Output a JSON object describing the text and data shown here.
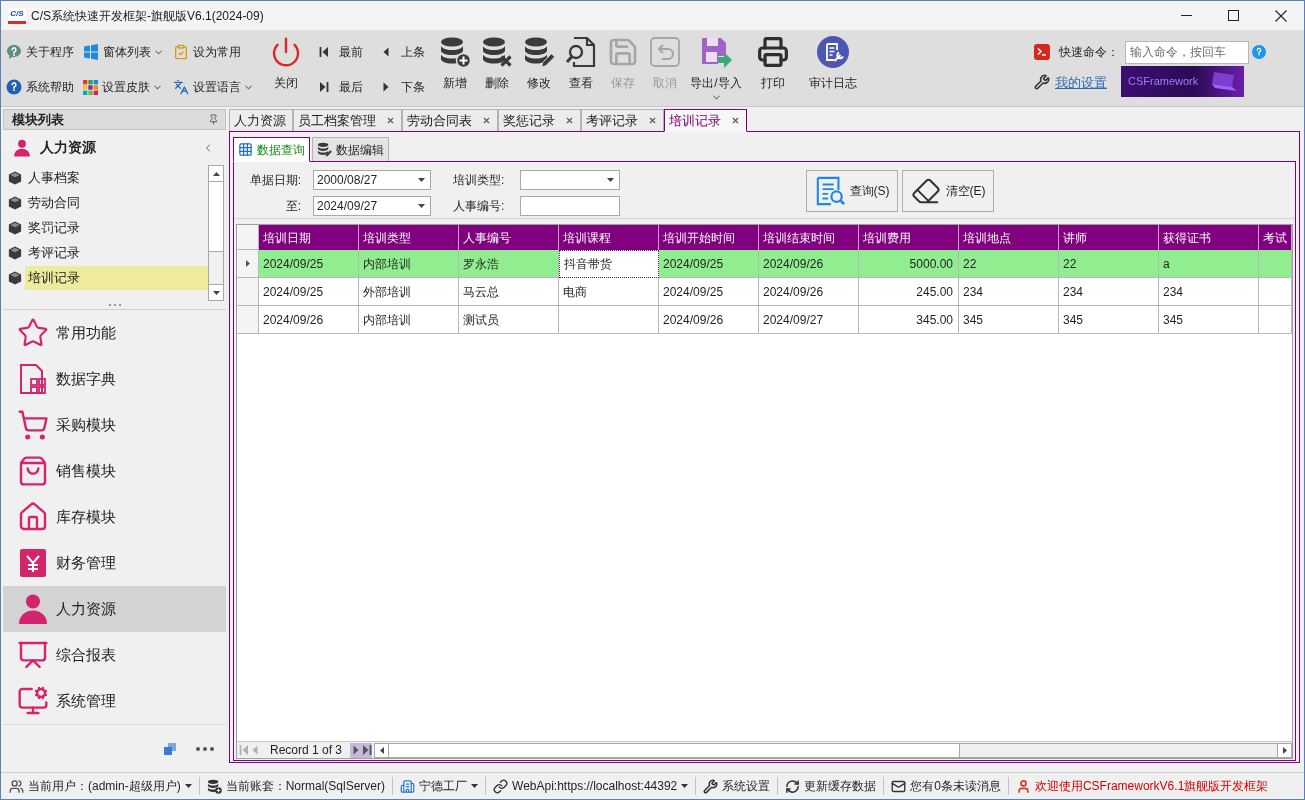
{
  "window": {
    "logo": "C/S",
    "title": "C/S系统快速开发框架-旗舰版V6.1(2024-09)"
  },
  "toolbar": {
    "small_buttons": [
      {
        "label": "关于程序",
        "dropdown": false
      },
      {
        "label": "系统帮助",
        "dropdown": false
      },
      {
        "label": "窗体列表",
        "dropdown": true
      },
      {
        "label": "设置皮肤",
        "dropdown": true
      },
      {
        "label": "设为常用",
        "dropdown": false
      },
      {
        "label": "设置语言",
        "dropdown": true
      }
    ],
    "close_button": "关闭",
    "record_nav": [
      "最前",
      "最后",
      "上条",
      "下条"
    ],
    "actions": [
      {
        "label": "新增",
        "disabled": false,
        "dropdown": false
      },
      {
        "label": "删除",
        "disabled": false,
        "dropdown": false
      },
      {
        "label": "修改",
        "disabled": false,
        "dropdown": false
      },
      {
        "label": "查看",
        "disabled": false,
        "dropdown": false
      },
      {
        "label": "保存",
        "disabled": true,
        "dropdown": false
      },
      {
        "label": "取消",
        "disabled": true,
        "dropdown": false
      },
      {
        "label": "导出/导入",
        "disabled": false,
        "dropdown": true
      },
      {
        "label": "打印",
        "disabled": false,
        "dropdown": false
      },
      {
        "label": "审计日志",
        "disabled": false,
        "dropdown": false
      }
    ],
    "quick_command": {
      "label": "快速命令：",
      "placeholder": "输入命令，按回车"
    },
    "settings_link": "我的设置",
    "banner": "CSFramework"
  },
  "sidebar": {
    "title": "模块列表",
    "group": "人力资源",
    "items": [
      {
        "label": "人事档案",
        "selected": false
      },
      {
        "label": "劳动合同",
        "selected": false
      },
      {
        "label": "奖罚记录",
        "selected": false
      },
      {
        "label": "考评记录",
        "selected": false
      },
      {
        "label": "培训记录",
        "selected": true
      }
    ],
    "modules": [
      {
        "label": "常用功能",
        "selected": false
      },
      {
        "label": "数据字典",
        "selected": false
      },
      {
        "label": "采购模块",
        "selected": false
      },
      {
        "label": "销售模块",
        "selected": false
      },
      {
        "label": "库存模块",
        "selected": false
      },
      {
        "label": "财务管理",
        "selected": false
      },
      {
        "label": "人力资源",
        "selected": true
      },
      {
        "label": "综合报表",
        "selected": false
      },
      {
        "label": "系统管理",
        "selected": false
      }
    ]
  },
  "tabs": [
    {
      "label": "人力资源",
      "closable": false,
      "selected": false
    },
    {
      "label": "员工档案管理",
      "closable": true,
      "selected": false
    },
    {
      "label": "劳动合同表",
      "closable": true,
      "selected": false
    },
    {
      "label": "奖惩记录",
      "closable": true,
      "selected": false
    },
    {
      "label": "考评记录",
      "closable": true,
      "selected": false
    },
    {
      "label": "培训记录",
      "closable": true,
      "selected": true
    }
  ],
  "sub_tabs": [
    {
      "label": "数据查询",
      "selected": true
    },
    {
      "label": "数据编辑",
      "selected": false
    }
  ],
  "filters": [
    {
      "label": "单据日期:",
      "kind": "date",
      "value": "2000/08/27"
    },
    {
      "label": "培训类型:",
      "kind": "dropdown"
    },
    {
      "label": "至:",
      "kind": "date",
      "value": "2024/09/27"
    },
    {
      "label": "人事编号:",
      "kind": "text"
    }
  ],
  "filter_buttons": [
    "查询(S)",
    "清空(E)"
  ],
  "table": {
    "columns": [
      {
        "label": "培训日期",
        "kind": "text"
      },
      {
        "label": "培训类型",
        "kind": "text"
      },
      {
        "label": "人事编号",
        "kind": "text"
      },
      {
        "label": "培训课程",
        "kind": "text"
      },
      {
        "label": "培训开始时间",
        "kind": "text"
      },
      {
        "label": "培训结束时间",
        "kind": "text"
      },
      {
        "label": "培训费用",
        "kind": "number"
      },
      {
        "label": "培训地点",
        "kind": "text"
      },
      {
        "label": "讲师",
        "kind": "text"
      },
      {
        "label": "获得证书",
        "kind": "text"
      },
      {
        "label": "考试",
        "kind": "text"
      }
    ],
    "rows": [
      {
        "selected": true,
        "cells": [
          {
            "text": "2024/09/25",
            "focused": false
          },
          {
            "text": "内部培训",
            "focused": false
          },
          {
            "text": "罗永浩",
            "focused": false
          },
          {
            "text": "抖音带货",
            "focused": true
          },
          {
            "text": "2024/09/25",
            "focused": false
          },
          {
            "text": "2024/09/26",
            "focused": false
          },
          {
            "text": "5000.00",
            "focused": false
          },
          {
            "text": "22",
            "focused": false
          },
          {
            "text": "22",
            "focused": false
          },
          {
            "text": "a",
            "focused": false
          },
          {
            "focused": false
          }
        ]
      },
      {
        "selected": false,
        "cells": [
          {
            "text": "2024/09/25",
            "focused": false
          },
          {
            "text": "外部培训",
            "focused": false
          },
          {
            "text": "马云总",
            "focused": false
          },
          {
            "text": "电商",
            "focused": false
          },
          {
            "text": "2024/09/25",
            "focused": false
          },
          {
            "text": "2024/09/26",
            "focused": false
          },
          {
            "text": "245.00",
            "focused": false
          },
          {
            "text": "234",
            "focused": false
          },
          {
            "text": "234",
            "focused": false
          },
          {
            "text": "234",
            "focused": false
          },
          {
            "focused": false
          }
        ]
      },
      {
        "selected": false,
        "cells": [
          {
            "text": "2024/09/26",
            "focused": false
          },
          {
            "text": "内部培训",
            "focused": false
          },
          {
            "text": "测试员",
            "focused": false
          },
          {
            "focused": false
          },
          {
            "text": "2024/09/26",
            "focused": false
          },
          {
            "text": "2024/09/27",
            "focused": false
          },
          {
            "text": "345.00",
            "focused": false
          },
          {
            "text": "345",
            "focused": false
          },
          {
            "text": "345",
            "focused": false
          },
          {
            "text": "345",
            "focused": false
          },
          {
            "focused": false
          }
        ]
      }
    ]
  },
  "navigator": "Record 1 of 3",
  "status_bar": [
    {
      "text": "当前用户：(admin-超级用户)",
      "dropdown": true,
      "kind": "normal"
    },
    {
      "text": "当前账套：Normal(SqlServer)",
      "dropdown": false,
      "kind": "normal"
    },
    {
      "text": "宁德工厂",
      "dropdown": true,
      "kind": "normal"
    },
    {
      "text": "WebApi:https://localhost:44392",
      "dropdown": true,
      "kind": "normal"
    },
    {
      "text": "系统设置",
      "dropdown": false,
      "kind": "normal"
    },
    {
      "text": "更新缓存数据",
      "dropdown": false,
      "kind": "normal"
    },
    {
      "text": "您有0条未读消息",
      "dropdown": false,
      "kind": "normal"
    },
    {
      "text": "欢迎使用CSFrameworkV6.1旗舰版开发框架",
      "dropdown": false,
      "kind": "alert"
    }
  ]
}
